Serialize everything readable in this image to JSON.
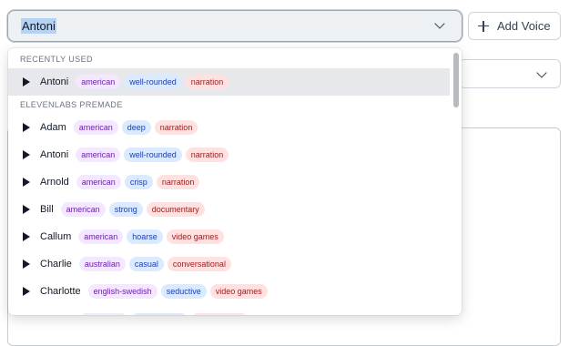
{
  "voice_select": {
    "value": "Antoni"
  },
  "add_voice": {
    "label": "Add Voice"
  },
  "dropdown": {
    "recent_header": "RECENTLY USED",
    "premade_header": "ELEVENLABS PREMADE",
    "recent": [
      {
        "name": "Antoni",
        "tags": [
          "american",
          "well-rounded",
          "narration"
        ]
      }
    ],
    "premade": [
      {
        "name": "Adam",
        "tags": [
          "american",
          "deep",
          "narration"
        ]
      },
      {
        "name": "Antoni",
        "tags": [
          "american",
          "well-rounded",
          "narration"
        ]
      },
      {
        "name": "Arnold",
        "tags": [
          "american",
          "crisp",
          "narration"
        ]
      },
      {
        "name": "Bill",
        "tags": [
          "american",
          "strong",
          "documentary"
        ]
      },
      {
        "name": "Callum",
        "tags": [
          "american",
          "hoarse",
          "video games"
        ]
      },
      {
        "name": "Charlie",
        "tags": [
          "australian",
          "casual",
          "conversational"
        ]
      },
      {
        "name": "Charlotte",
        "tags": [
          "english-swedish",
          "seductive",
          "video games"
        ]
      }
    ]
  },
  "colors": {
    "tag_accent_purple": "#f3e8ff",
    "tag_descriptor_blue": "#dbeafe",
    "tag_usecase_red": "#fee2e2",
    "selected_row": "#e6e8eb"
  }
}
